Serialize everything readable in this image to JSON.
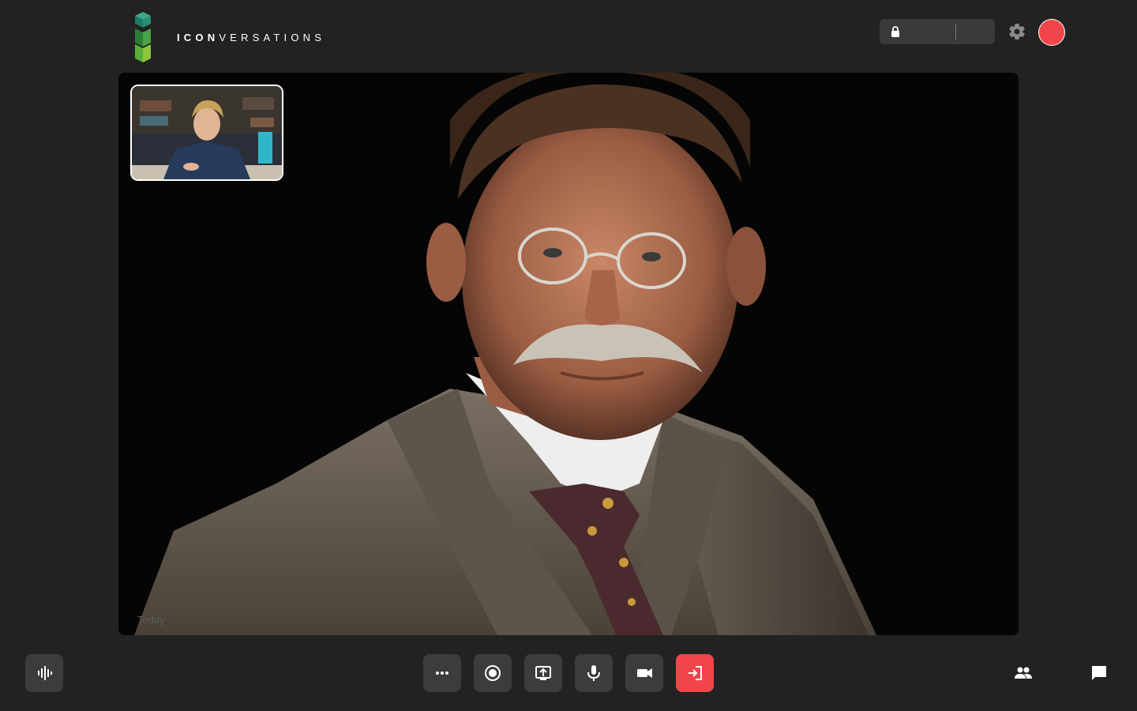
{
  "app": {
    "brand_bold": "ICON",
    "brand_light": "VERSATIONS"
  },
  "header": {
    "room_label": "",
    "room_extra": "",
    "lock_icon": "lock-icon",
    "settings_icon": "gear-icon",
    "status_color": "#f0464b"
  },
  "stage": {
    "remote_name": "Teddy"
  },
  "controls": {
    "audio_visualizer_icon": "audio-wave-icon",
    "more_icon": "more-icon",
    "record_icon": "record-icon",
    "share_screen_icon": "share-screen-icon",
    "mic_icon": "microphone-icon",
    "camera_icon": "camera-icon",
    "leave_icon": "leave-icon",
    "participants_icon": "people-icon",
    "chat_icon": "chat-icon"
  },
  "colors": {
    "background": "#222222",
    "control": "#3c3c3c",
    "danger": "#f0464b",
    "brand_green": "#3aa55d"
  }
}
